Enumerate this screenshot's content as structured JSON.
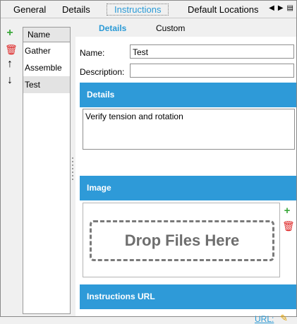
{
  "tabs": {
    "items": [
      {
        "label": "General"
      },
      {
        "label": "Details"
      },
      {
        "label": "Instructions"
      },
      {
        "label": "Default Locations"
      }
    ],
    "nav_left": "◀",
    "nav_right": "▶",
    "nav_menu": "▤"
  },
  "toolbar": {
    "add_icon": "+",
    "delete_icon": "🗑",
    "up_icon": "↑",
    "down_icon": "↓"
  },
  "steps": {
    "header": "Name",
    "rows": [
      "Gather",
      "Assemble",
      "Test"
    ]
  },
  "subtabs": {
    "details": "Details",
    "custom": "Custom"
  },
  "form": {
    "name_label": "Name:",
    "name_value": "Test",
    "description_label": "Description:",
    "description_value": ""
  },
  "sections": {
    "details": "Details",
    "image": "Image",
    "instructions_url": "Instructions URL"
  },
  "details_text": "Verify tension and rotation",
  "image": {
    "drop_text": "Drop Files Here",
    "add_icon": "+",
    "delete_icon": "🗑"
  },
  "url": {
    "label": "URL:",
    "edit_icon": "✎"
  },
  "colors": {
    "accent": "#2e9ad8",
    "active_tab": "#2a9ad6",
    "add_green": "#3aa83a",
    "delete_red": "#dd2222"
  }
}
